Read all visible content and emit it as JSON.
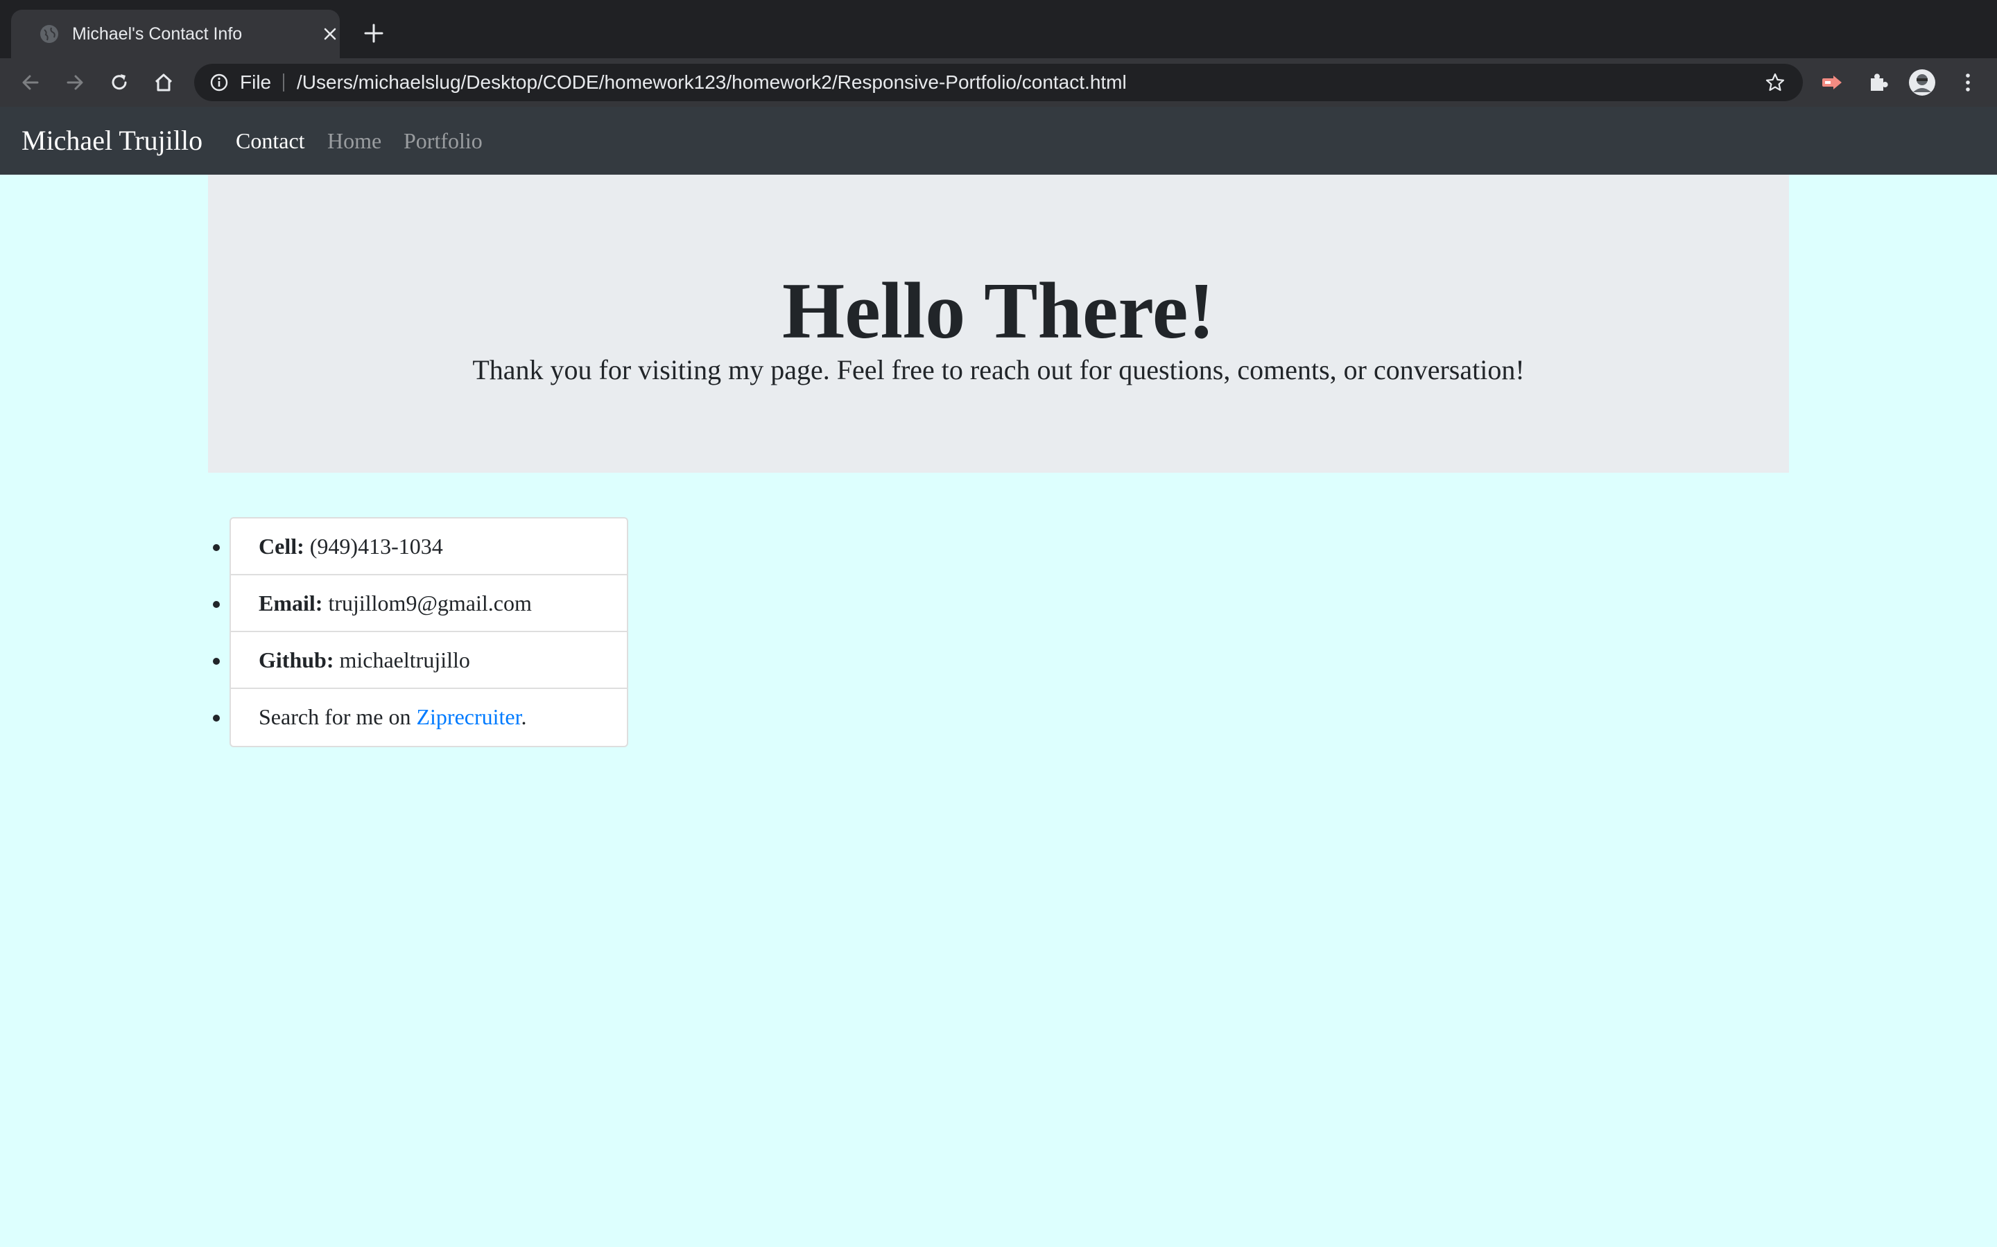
{
  "browser": {
    "tab_title": "Michael's Contact Info",
    "scheme_label": "File",
    "url": "/Users/michaelslug/Desktop/CODE/homework123/homework2/Responsive-Portfolio/contact.html",
    "icons": [
      "globe-icon",
      "close-icon",
      "plus-icon",
      "back-arrow-icon",
      "forward-arrow-icon",
      "reload-icon",
      "home-icon",
      "info-icon",
      "star-icon",
      "extension-arrow-icon",
      "puzzle-icon",
      "avatar",
      "kebab-menu-icon"
    ]
  },
  "navbar": {
    "brand": "Michael Trujillo",
    "links": [
      {
        "label": "Contact",
        "active": true
      },
      {
        "label": "Home",
        "active": false
      },
      {
        "label": "Portfolio",
        "active": false
      }
    ],
    "colors": {
      "background": "#343a40",
      "active": "#ffffff",
      "muted": "#9a9da0"
    }
  },
  "hero": {
    "title": "Hello There!",
    "subtitle": "Thank you for visiting my page. Feel free to reach out for questions, coments, or conversation!"
  },
  "contact": {
    "cell_label": "Cell:",
    "cell_value": "(949)413-1034",
    "email_label": "Email:",
    "email_value": "trujillom9@gmail.com",
    "github_label": "Github:",
    "github_value": "michaeltrujillo",
    "search_prefix": "Search for me on ",
    "search_link": "Ziprecruiter",
    "search_suffix": "."
  },
  "colors": {
    "page_background": "#ddfffe",
    "jumbotron": "#e9ecef",
    "link": "#007bff"
  }
}
